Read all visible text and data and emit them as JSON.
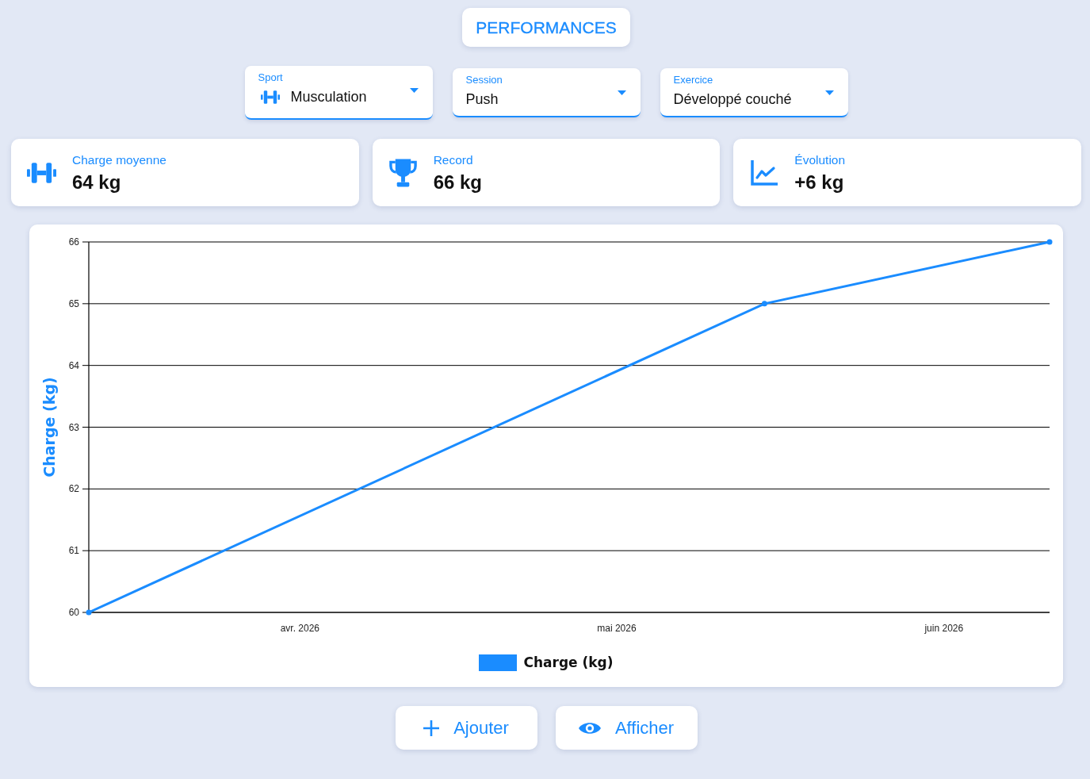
{
  "header": {
    "title": "PERFORMANCES"
  },
  "filters": [
    {
      "kind": "sport",
      "label": "Sport",
      "value": "Musculation"
    },
    {
      "kind": "session",
      "label": "Session",
      "value": "Push"
    },
    {
      "kind": "exercise",
      "label": "Exercice",
      "value": "Développé couché"
    }
  ],
  "stats": [
    {
      "kind": "average",
      "label": "Charge moyenne",
      "value": "64 kg"
    },
    {
      "kind": "record",
      "label": "Record",
      "value": "66 kg"
    },
    {
      "kind": "trend",
      "label": "Évolution",
      "value": "+6 kg"
    }
  ],
  "chart": {
    "chart_data": {
      "type": "line",
      "ylabel": "Charge (kg)",
      "grid": true,
      "categories": [
        null,
        null,
        null,
        null,
        null,
        null,
        null,
        null,
        null,
        null,
        null,
        null,
        null,
        null,
        null,
        null,
        null,
        null,
        null,
        null,
        "avr. 2026",
        null,
        null,
        null,
        null,
        null,
        null,
        null,
        null,
        null,
        null,
        null,
        null,
        null,
        null,
        null,
        null,
        null,
        null,
        null,
        null,
        null,
        null,
        null,
        null,
        null,
        null,
        null,
        null,
        null,
        "mai 2026",
        null,
        null,
        null,
        null,
        null,
        null,
        null,
        null,
        null,
        null,
        null,
        null,
        null,
        null,
        null,
        null,
        null,
        null,
        null,
        null,
        null,
        null,
        null,
        null,
        null,
        null,
        null,
        null,
        null,
        null,
        "juin 2026",
        null,
        null,
        null,
        null,
        null,
        null,
        null,
        null,
        null,
        null
      ],
      "series": [
        {
          "name": "Charge (kg)",
          "color": "#1a8cff",
          "marker": true,
          "values": [
            60,
            null,
            null,
            null,
            null,
            null,
            null,
            null,
            null,
            null,
            null,
            null,
            null,
            null,
            null,
            null,
            null,
            null,
            null,
            null,
            null,
            null,
            null,
            null,
            null,
            null,
            null,
            null,
            null,
            null,
            null,
            null,
            null,
            null,
            null,
            null,
            null,
            null,
            null,
            null,
            null,
            null,
            null,
            null,
            null,
            null,
            null,
            null,
            null,
            null,
            null,
            null,
            null,
            null,
            null,
            null,
            null,
            null,
            null,
            null,
            null,
            null,
            null,
            null,
            65,
            null,
            null,
            null,
            null,
            null,
            null,
            null,
            null,
            null,
            null,
            null,
            null,
            null,
            null,
            null,
            null,
            null,
            null,
            null,
            null,
            null,
            null,
            null,
            null,
            null,
            null,
            66
          ]
        }
      ],
      "ylim": [
        60,
        66
      ],
      "yticks": [
        60,
        61,
        62,
        63,
        64,
        65,
        66
      ]
    }
  },
  "actions": [
    {
      "kind": "add",
      "label": "Ajouter"
    },
    {
      "kind": "view",
      "label": "Afficher"
    }
  ]
}
